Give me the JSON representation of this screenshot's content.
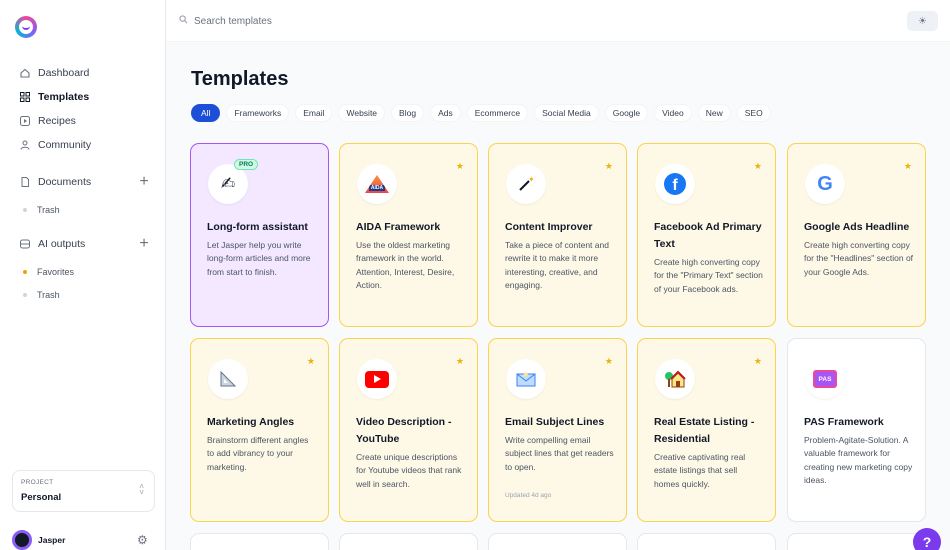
{
  "sidebar": {
    "nav": [
      {
        "label": "Dashboard",
        "icon": "home-icon"
      },
      {
        "label": "Templates",
        "icon": "grid-icon"
      },
      {
        "label": "Recipes",
        "icon": "recipe-icon"
      },
      {
        "label": "Community",
        "icon": "people-icon"
      }
    ],
    "documents": {
      "label": "Documents",
      "trash": "Trash"
    },
    "ai_outputs": {
      "label": "AI outputs",
      "favorites": "Favorites",
      "trash": "Trash"
    },
    "project": {
      "caption": "PROJECT",
      "value": "Personal"
    },
    "user": {
      "name": "Jasper"
    }
  },
  "search": {
    "placeholder": "Search templates"
  },
  "page": {
    "title": "Templates"
  },
  "filters": [
    "All",
    "Frameworks",
    "Email",
    "Website",
    "Blog",
    "Ads",
    "Ecommerce",
    "Social Media",
    "Google",
    "Video",
    "New",
    "SEO"
  ],
  "cards": [
    {
      "title": "Long-form assistant",
      "desc": "Let Jasper help you write long-form articles and more from start to finish.",
      "badge": "PRO",
      "icon": "pencil-hand-icon"
    },
    {
      "title": "AIDA Framework",
      "desc": "Use the oldest marketing framework in the world. Attention, Interest, Desire, Action.",
      "icon": "aida-icon"
    },
    {
      "title": "Content Improver",
      "desc": "Take a piece of content and rewrite it to make it more interesting, creative, and engaging.",
      "icon": "magic-wand-icon"
    },
    {
      "title": "Facebook Ad Primary Text",
      "desc": "Create high converting copy for the \"Primary Text\" section of your Facebook ads.",
      "icon": "facebook-icon"
    },
    {
      "title": "Google Ads Headline",
      "desc": "Create high converting copy for the \"Headlines\" section of your Google Ads.",
      "icon": "google-icon"
    },
    {
      "title": "Marketing Angles",
      "desc": "Brainstorm different angles to add vibrancy to your marketing.",
      "icon": "triangle-ruler-icon"
    },
    {
      "title": "Video Description - YouTube",
      "desc": "Create unique descriptions for Youtube videos that rank well in search.",
      "icon": "youtube-icon"
    },
    {
      "title": "Email Subject Lines",
      "desc": "Write compelling email subject lines that get readers to open.",
      "updated": "Updated 4d ago",
      "icon": "envelope-icon"
    },
    {
      "title": "Real Estate Listing - Residential",
      "desc": "Creative captivating real estate listings that sell homes quickly.",
      "icon": "house-icon"
    },
    {
      "title": "PAS Framework",
      "desc": "Problem-Agitate-Solution. A valuable framework for creating new marketing copy ideas.",
      "icon": "pas-icon"
    }
  ],
  "help": {
    "label": "?"
  },
  "colors": {
    "accent": "#1d4ed8",
    "favorite_card_bg": "#fef9e7",
    "favorite_card_border": "#fcd34d",
    "pro_card_bg": "#f3e8ff",
    "help_button": "#7c3aed"
  }
}
